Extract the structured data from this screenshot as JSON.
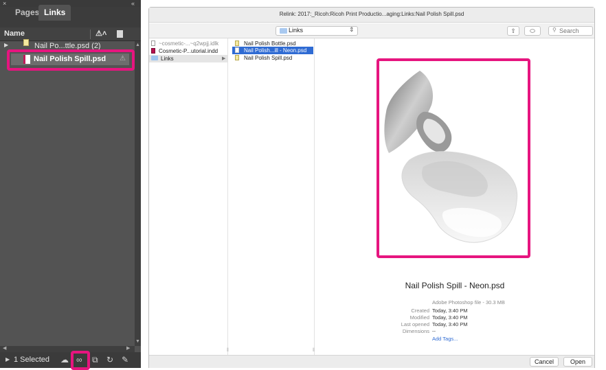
{
  "links_panel": {
    "tabs": [
      {
        "label": "Pages"
      },
      {
        "label": "Links"
      }
    ],
    "column_header": "Name",
    "rows": [
      {
        "label": "Nail Po...ttle.psd (2)"
      },
      {
        "label": "Nail Polish Spill.psd"
      }
    ],
    "status": "1 Selected"
  },
  "dialog": {
    "title": "Relink: 2017:_Ricoh:Ricoh Print Productio...aging:Links:Nail Polish Spill.psd",
    "location": "Links",
    "search_placeholder": "Search",
    "column1": [
      {
        "label": "~cosmetic-...~q2wpjj.idlk"
      },
      {
        "label": "Cosmetic-P...utorial.indd"
      },
      {
        "label": "Links"
      }
    ],
    "column2": [
      {
        "label": "Nail Polish Bottle.psd"
      },
      {
        "label": "Nail Polish...ill - Neon.psd"
      },
      {
        "label": "Nail Polish Spill.psd"
      }
    ],
    "preview": {
      "name": "Nail Polish Spill - Neon.psd",
      "kind": "Adobe Photoshop file - 30.3 MB",
      "info": {
        "created_label": "Created",
        "created_value": "Today, 3:40 PM",
        "modified_label": "Modified",
        "modified_value": "Today, 3:40 PM",
        "opened_label": "Last opened",
        "opened_value": "Today, 3:40 PM",
        "dimensions_label": "Dimensions",
        "dimensions_value": "--"
      },
      "add_tags": "Add Tags..."
    },
    "buttons": {
      "cancel": "Cancel",
      "open": "Open"
    }
  },
  "colors": {
    "callout": "#e6157f",
    "selection": "#2f6bd3",
    "panel_bg": "#535353"
  }
}
